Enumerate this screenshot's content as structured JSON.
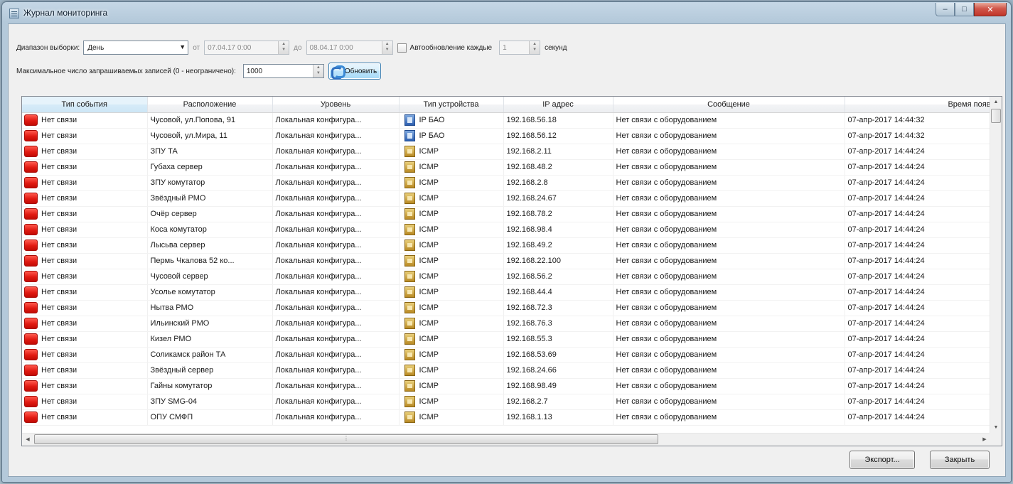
{
  "window": {
    "title": "Журнал мониторинга",
    "minimize": "–",
    "maximize": "□",
    "close": "✕"
  },
  "filters": {
    "range_label": "Диапазон выборки:",
    "range_value": "День",
    "from_label": "от",
    "from_value": "07.04.17 0:00",
    "to_label": "до",
    "to_value": "08.04.17 0:00",
    "autorefresh_label": "Автообновление каждые",
    "autorefresh_checked": false,
    "autorefresh_value": "1",
    "seconds_label": "секунд",
    "max_records_label": "Максимальное число запрашиваемых записей (0 - неограничено):",
    "max_records_value": "1000",
    "refresh_button": "Обновить"
  },
  "table": {
    "columns": [
      "Тип события",
      "Расположение",
      "Уровень",
      "Тип устройства",
      "IP адрес",
      "Сообщение",
      "Время появ"
    ],
    "rows": [
      {
        "event": "Нет связи",
        "location": "Чусовой, ул.Попова, 91",
        "level": "Локальная конфигура...",
        "device_icon": "ip-bao",
        "device": "IP БАО",
        "ip": "192.168.56.18",
        "message": "Нет связи с оборудованием",
        "time": "07-апр-2017 14:44:32"
      },
      {
        "event": "Нет связи",
        "location": "Чусовой, ул.Мира, 11",
        "level": "Локальная конфигура...",
        "device_icon": "ip-bao",
        "device": "IP БАО",
        "ip": "192.168.56.12",
        "message": "Нет связи с оборудованием",
        "time": "07-апр-2017 14:44:32"
      },
      {
        "event": "Нет связи",
        "location": "ЗПУ ТА",
        "level": "Локальная конфигура...",
        "device_icon": "icmp",
        "device": "ICMP",
        "ip": "192.168.2.11",
        "message": "Нет связи с оборудованием",
        "time": "07-апр-2017 14:44:24"
      },
      {
        "event": "Нет связи",
        "location": "Губаха сервер",
        "level": "Локальная конфигура...",
        "device_icon": "icmp",
        "device": "ICMP",
        "ip": "192.168.48.2",
        "message": "Нет связи с оборудованием",
        "time": "07-апр-2017 14:44:24"
      },
      {
        "event": "Нет связи",
        "location": "ЗПУ комутатор",
        "level": "Локальная конфигура...",
        "device_icon": "icmp",
        "device": "ICMP",
        "ip": "192.168.2.8",
        "message": "Нет связи с оборудованием",
        "time": "07-апр-2017 14:44:24"
      },
      {
        "event": "Нет связи",
        "location": "Звёздный РМО",
        "level": "Локальная конфигура...",
        "device_icon": "icmp",
        "device": "ICMP",
        "ip": "192.168.24.67",
        "message": "Нет связи с оборудованием",
        "time": "07-апр-2017 14:44:24"
      },
      {
        "event": "Нет связи",
        "location": "Очёр сервер",
        "level": "Локальная конфигура...",
        "device_icon": "icmp",
        "device": "ICMP",
        "ip": "192.168.78.2",
        "message": "Нет связи с оборудованием",
        "time": "07-апр-2017 14:44:24"
      },
      {
        "event": "Нет связи",
        "location": "Коса комутатор",
        "level": "Локальная конфигура...",
        "device_icon": "icmp",
        "device": "ICMP",
        "ip": "192.168.98.4",
        "message": "Нет связи с оборудованием",
        "time": "07-апр-2017 14:44:24"
      },
      {
        "event": "Нет связи",
        "location": "Лысьва сервер",
        "level": "Локальная конфигура...",
        "device_icon": "icmp",
        "device": "ICMP",
        "ip": "192.168.49.2",
        "message": "Нет связи с оборудованием",
        "time": "07-апр-2017 14:44:24"
      },
      {
        "event": "Нет связи",
        "location": "Пермь Чкалова 52 ко...",
        "level": "Локальная конфигура...",
        "device_icon": "icmp",
        "device": "ICMP",
        "ip": "192.168.22.100",
        "message": "Нет связи с оборудованием",
        "time": "07-апр-2017 14:44:24"
      },
      {
        "event": "Нет связи",
        "location": "Чусовой сервер",
        "level": "Локальная конфигура...",
        "device_icon": "icmp",
        "device": "ICMP",
        "ip": "192.168.56.2",
        "message": "Нет связи с оборудованием",
        "time": "07-апр-2017 14:44:24"
      },
      {
        "event": "Нет связи",
        "location": "Усолье комутатор",
        "level": "Локальная конфигура...",
        "device_icon": "icmp",
        "device": "ICMP",
        "ip": "192.168.44.4",
        "message": "Нет связи с оборудованием",
        "time": "07-апр-2017 14:44:24"
      },
      {
        "event": "Нет связи",
        "location": "Нытва РМО",
        "level": "Локальная конфигура...",
        "device_icon": "icmp",
        "device": "ICMP",
        "ip": "192.168.72.3",
        "message": "Нет связи с оборудованием",
        "time": "07-апр-2017 14:44:24"
      },
      {
        "event": "Нет связи",
        "location": "Ильинский РМО",
        "level": "Локальная конфигура...",
        "device_icon": "icmp",
        "device": "ICMP",
        "ip": "192.168.76.3",
        "message": "Нет связи с оборудованием",
        "time": "07-апр-2017 14:44:24"
      },
      {
        "event": "Нет связи",
        "location": "Кизел РМО",
        "level": "Локальная конфигура...",
        "device_icon": "icmp",
        "device": "ICMP",
        "ip": "192.168.55.3",
        "message": "Нет связи с оборудованием",
        "time": "07-апр-2017 14:44:24"
      },
      {
        "event": "Нет связи",
        "location": "Соликамск район ТА",
        "level": "Локальная конфигура...",
        "device_icon": "icmp",
        "device": "ICMP",
        "ip": "192.168.53.69",
        "message": "Нет связи с оборудованием",
        "time": "07-апр-2017 14:44:24"
      },
      {
        "event": "Нет связи",
        "location": "Звёздный сервер",
        "level": "Локальная конфигура...",
        "device_icon": "icmp",
        "device": "ICMP",
        "ip": "192.168.24.66",
        "message": "Нет связи с оборудованием",
        "time": "07-апр-2017 14:44:24"
      },
      {
        "event": "Нет связи",
        "location": "Гайны комутатор",
        "level": "Локальная конфигура...",
        "device_icon": "icmp",
        "device": "ICMP",
        "ip": "192.168.98.49",
        "message": "Нет связи с оборудованием",
        "time": "07-апр-2017 14:44:24"
      },
      {
        "event": "Нет связи",
        "location": "ЗПУ SMG-04",
        "level": "Локальная конфигура...",
        "device_icon": "icmp",
        "device": "ICMP",
        "ip": "192.168.2.7",
        "message": "Нет связи с оборудованием",
        "time": "07-апр-2017 14:44:24"
      },
      {
        "event": "Нет связи",
        "location": "ОПУ СМФП",
        "level": "Локальная конфигура...",
        "device_icon": "icmp",
        "device": "ICMP",
        "ip": "192.168.1.13",
        "message": "Нет связи с оборудованием",
        "time": "07-апр-2017 14:44:24"
      }
    ]
  },
  "footer": {
    "export_button": "Экспорт...",
    "close_button": "Закрыть"
  },
  "colors": {
    "status_error": "#e11a12",
    "accent": "#3c7fb1"
  }
}
